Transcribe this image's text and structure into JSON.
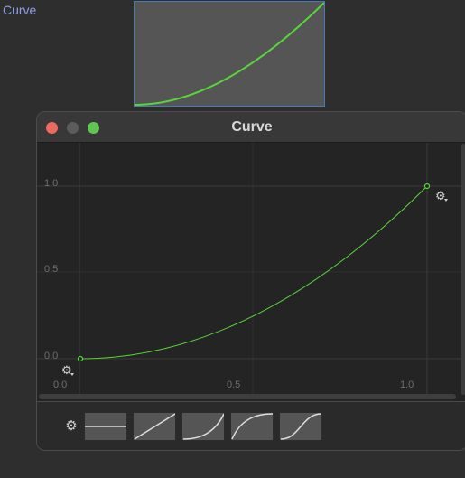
{
  "property": {
    "label": "Curve"
  },
  "window": {
    "title": "Curve",
    "buttons": [
      "close",
      "minimize",
      "zoom"
    ]
  },
  "graph": {
    "x_ticks": [
      "0.0",
      "0.5",
      "1.0"
    ],
    "y_ticks": [
      "1.0",
      "0.5",
      "0.0"
    ],
    "curve_color": "#59d43c",
    "keys": [
      {
        "time": 0.0,
        "value": 0.0,
        "menu_icon": "gear-dropdown-icon"
      },
      {
        "time": 1.0,
        "value": 1.0,
        "menu_icon": "gear-dropdown-icon"
      }
    ]
  },
  "presets": {
    "settings_icon": "gear-icon",
    "items": [
      {
        "name": "constant"
      },
      {
        "name": "linear"
      },
      {
        "name": "ease-in"
      },
      {
        "name": "ease-out"
      },
      {
        "name": "ease-in-out"
      }
    ]
  }
}
